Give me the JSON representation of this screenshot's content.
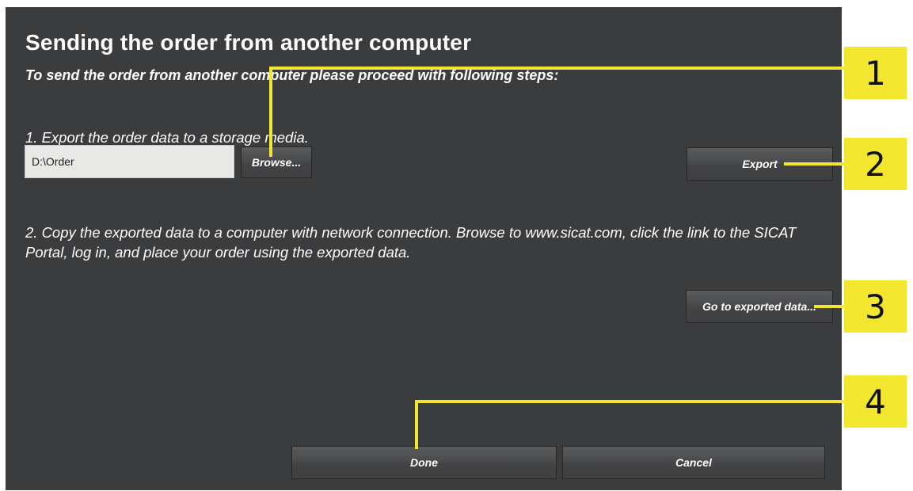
{
  "dialog": {
    "title": "Sending the order from another computer",
    "subtitle": "To send the order from another computer please proceed with following steps:",
    "step1": {
      "text": "1. Export the order data to a storage media.",
      "path_value": "D:\\Order",
      "browse_label": "Browse...",
      "export_label": "Export"
    },
    "step2": {
      "text": "2. Copy the exported data to a computer with network connection. Browse to www.sicat.com, click the link to the SICAT Portal, log in, and place your order using the exported data.",
      "goto_label": "Go to exported data..."
    },
    "footer": {
      "done_label": "Done",
      "cancel_label": "Cancel"
    }
  },
  "callouts": {
    "markers": [
      "1",
      "2",
      "3",
      "4"
    ],
    "color": "#f2e62e"
  },
  "colors": {
    "dialog_background": "#3b3c3e",
    "text": "#ffffff",
    "input_background": "#e8e8e6"
  }
}
